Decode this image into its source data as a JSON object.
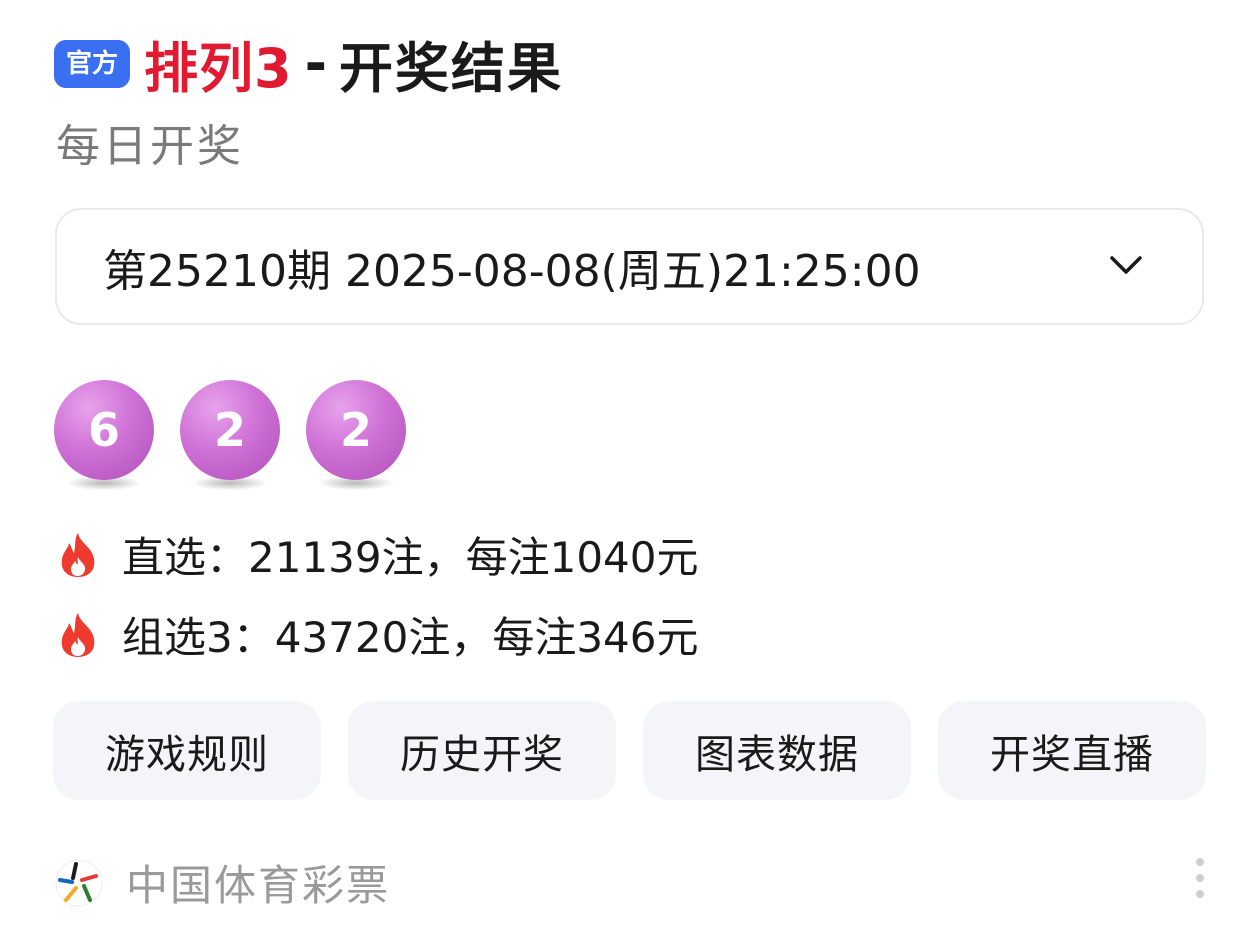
{
  "header": {
    "badge": "官方",
    "game_name": "排列3",
    "separator": "-",
    "title": "开奖结果"
  },
  "subtitle": "每日开奖",
  "draw_selector": {
    "value": "第25210期 2025-08-08(周五)21:25:00",
    "icon": "chevron-down-icon"
  },
  "balls": [
    "6",
    "2",
    "2"
  ],
  "prizes": [
    {
      "icon": "fire-icon",
      "text": "直选：21139注，每注1040元"
    },
    {
      "icon": "fire-icon",
      "text": "组选3：43720注，每注346元"
    }
  ],
  "buttons": [
    {
      "label": "游戏规则"
    },
    {
      "label": "历史开奖"
    },
    {
      "label": "图表数据"
    },
    {
      "label": "开奖直播"
    }
  ],
  "footer": {
    "source": "中国体育彩票",
    "logo_icon": "china-sports-lottery-logo-icon",
    "more_icon": "more-vertical-icon"
  },
  "colors": {
    "accent_red": "#e11931",
    "badge_blue": "#3a6ff2",
    "ball_purple": "#cf71d6",
    "fire_red": "#ef3b2d"
  }
}
